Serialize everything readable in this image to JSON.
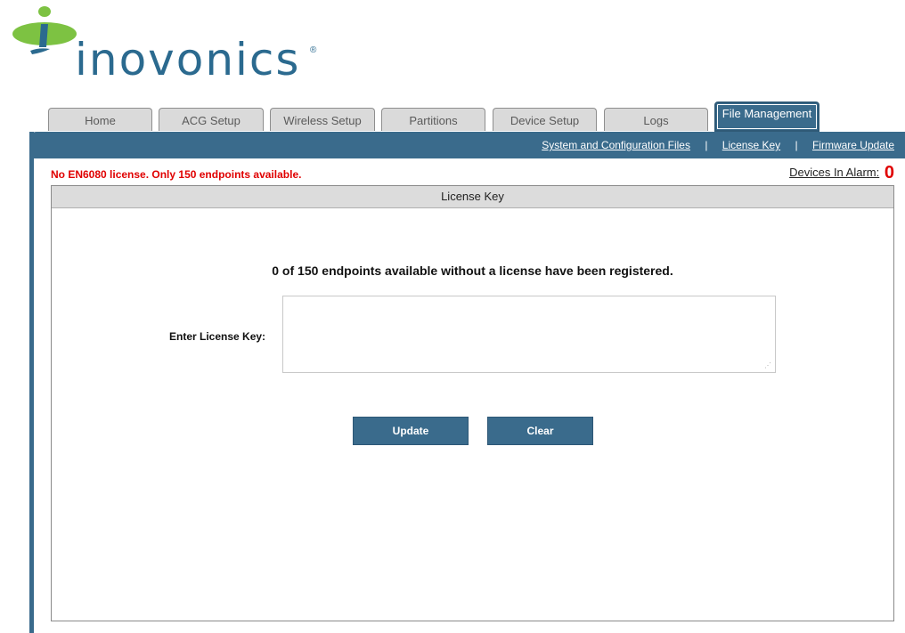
{
  "brand": {
    "name": "inovonics",
    "registered": "®",
    "primary_color": "#2b6a8f",
    "accent_color": "#7dc242"
  },
  "tabs": [
    {
      "label": "Home",
      "active": false
    },
    {
      "label": "ACG Setup",
      "active": false
    },
    {
      "label": "Wireless Setup",
      "active": false
    },
    {
      "label": "Partitions",
      "active": false
    },
    {
      "label": "Device Setup",
      "active": false
    },
    {
      "label": "Logs",
      "active": false
    },
    {
      "label": "File Management",
      "active": true
    }
  ],
  "subnav": {
    "links": [
      "System and Configuration Files",
      "License Key",
      "Firmware Update"
    ],
    "separator": "|"
  },
  "status": {
    "warning": "No EN6080 license. Only 150 endpoints available.",
    "alarm_label": "Devices In Alarm:",
    "alarm_count": "0"
  },
  "panel": {
    "title": "License Key",
    "message": "0 of 150 endpoints available without a license have been registered.",
    "key_label": "Enter License Key:",
    "key_value": "",
    "buttons": {
      "update": "Update",
      "clear": "Clear"
    }
  },
  "colors": {
    "header_bar": "#3a6b8c",
    "warning": "#e00000",
    "tab_inactive": "#dadada"
  }
}
